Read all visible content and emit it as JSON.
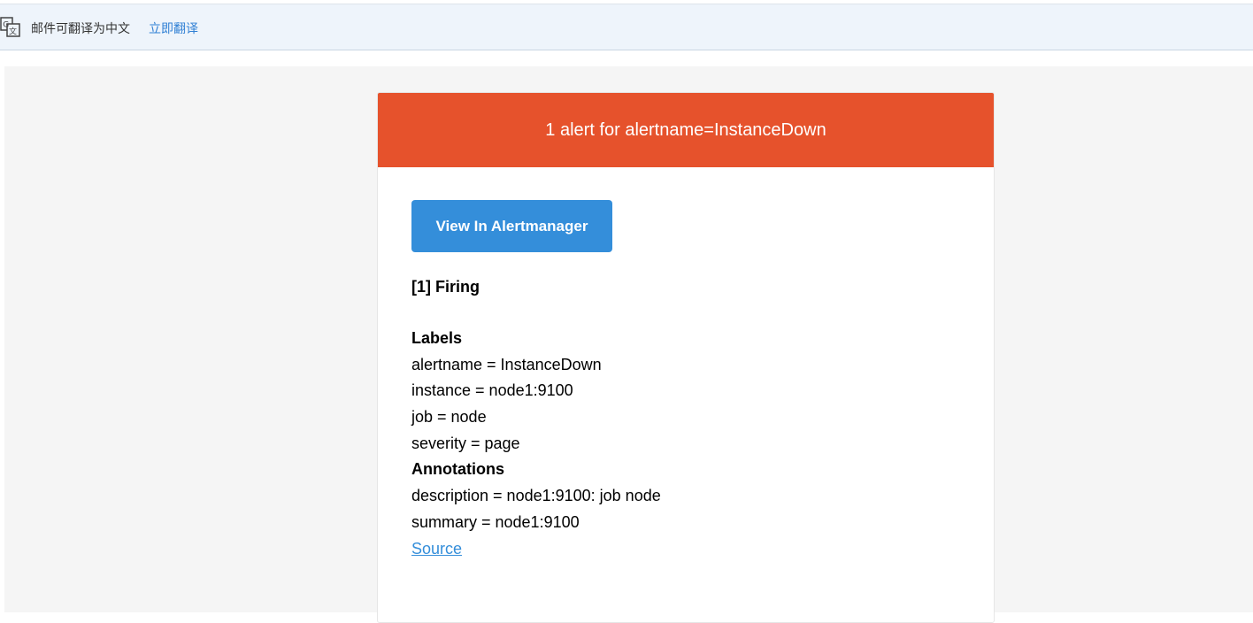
{
  "translate_bar": {
    "icon": "translate-icon",
    "message": "邮件可翻译为中文",
    "action_label": "立即翻译",
    "background": "#eef4fb",
    "link_color": "#2f7fd4"
  },
  "email": {
    "header_title": "1 alert for alertname=InstanceDown",
    "header_color": "#e6522c",
    "button_label": "View In Alertmanager",
    "button_color": "#348eda",
    "firing_heading": "[1] Firing",
    "labels_heading": "Labels",
    "labels": [
      "alertname = InstanceDown",
      "instance = node1:9100",
      "job = node",
      "severity = page"
    ],
    "annotations_heading": "Annotations",
    "annotations": [
      "description = node1:9100: job node",
      "summary = node1:9100"
    ],
    "source_link": "Source"
  }
}
